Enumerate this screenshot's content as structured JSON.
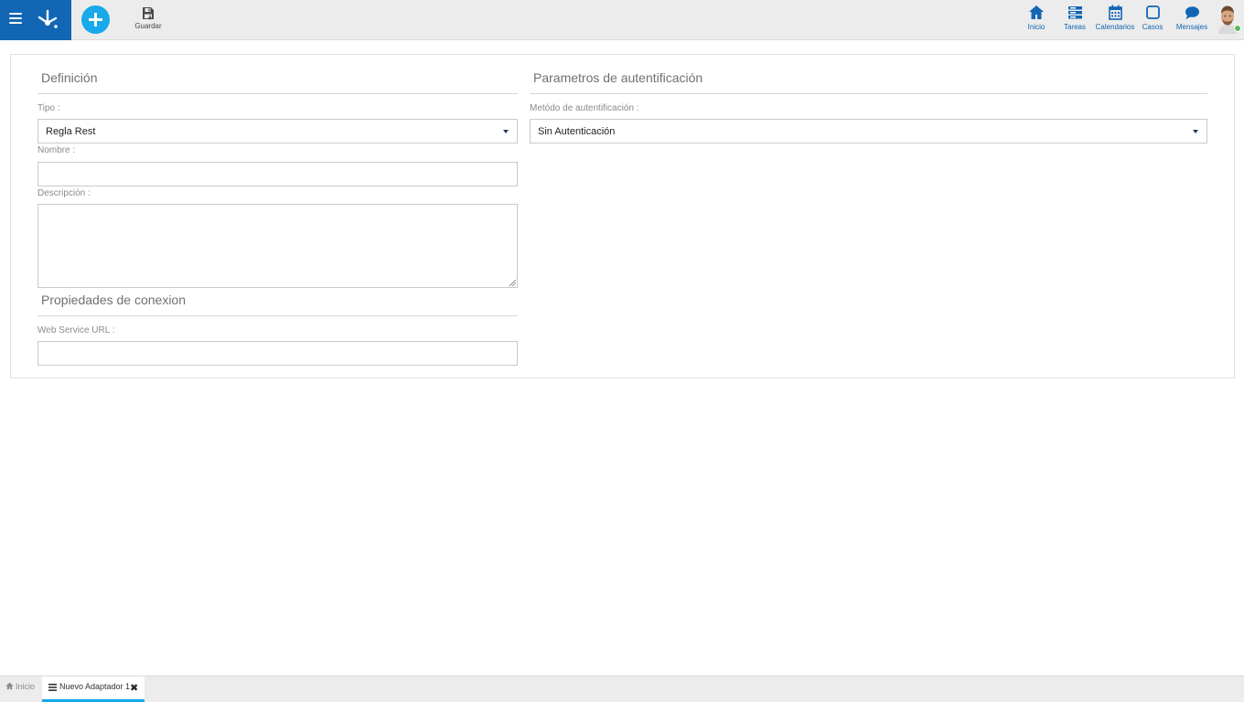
{
  "toolbar": {
    "save_label": "Guardar"
  },
  "nav": {
    "inicio": "Inicio",
    "tareas": "Tareas",
    "calendarios": "Calendarios",
    "casos": "Casos",
    "mensajes": "Mensajes"
  },
  "colors": {
    "brand": "#1266b4",
    "accent": "#17a9e9",
    "status_online": "#5cb85c"
  },
  "definicion": {
    "title": "Definición",
    "tipo_label": "Tipo :",
    "tipo_value": "Regla Rest",
    "nombre_label": "Nombre :",
    "nombre_value": "",
    "descripcion_label": "Descripción :",
    "descripcion_value": ""
  },
  "conexion": {
    "title": "Propiedades de conexion",
    "url_label": "Web Service URL :",
    "url_value": ""
  },
  "autenticacion": {
    "title": "Parametros de autentificación",
    "metodo_label": "Metódo de autentificación :",
    "metodo_value": "Sin Autenticación"
  },
  "tabs": {
    "home_label": "Inicio",
    "active_label": "Nuevo Adaptador 1",
    "close_glyph": "✖"
  },
  "icons": [
    "menu-icon",
    "logo-icon",
    "plus-icon",
    "save-icon",
    "home-icon",
    "tasks-icon",
    "calendar-icon",
    "cases-icon",
    "messages-icon",
    "list-icon",
    "close-icon"
  ]
}
